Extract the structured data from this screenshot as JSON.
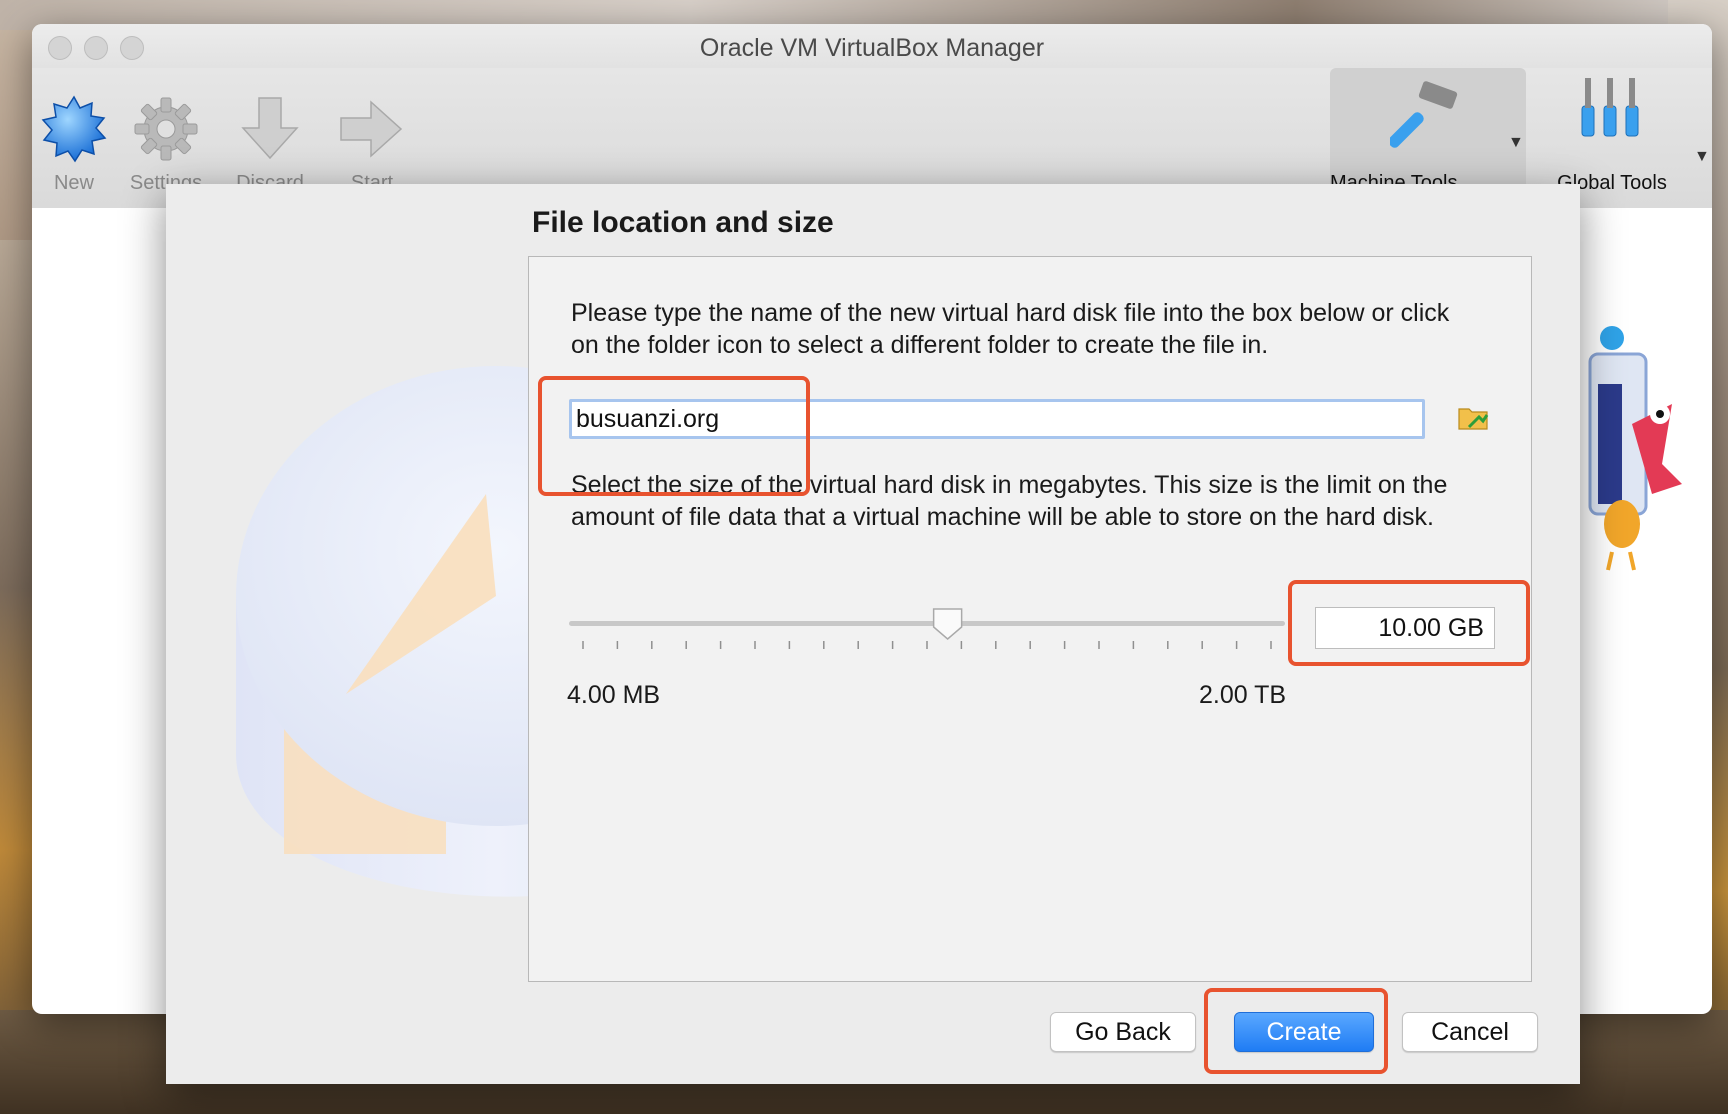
{
  "window": {
    "title": "Oracle VM VirtualBox Manager"
  },
  "toolbar": {
    "items": [
      {
        "label": "New",
        "icon": "new-icon"
      },
      {
        "label": "Settings",
        "icon": "gear-icon"
      },
      {
        "label": "Discard",
        "icon": "discard-arrow-icon"
      },
      {
        "label": "Start",
        "icon": "start-arrow-icon"
      }
    ],
    "machine_tools_label": "Machine Tools",
    "global_tools_label": "Global Tools"
  },
  "dialog": {
    "heading": "File location and size",
    "location_text": "Please type the name of the new virtual hard disk file into the box below or click on the folder icon to select a different folder to create the file in.",
    "filename_value": "busuanzi.org",
    "size_text": "Select the size of the virtual hard disk in megabytes. This size is the limit on the amount of file data that a virtual machine will be able to store on the hard disk.",
    "size_value": "10.00 GB",
    "slider_fraction": 0.53,
    "min_label": "4.00 MB",
    "max_label": "2.00 TB",
    "buttons": {
      "back": "Go Back",
      "create": "Create",
      "cancel": "Cancel"
    }
  },
  "colors": {
    "accent": "#1f7cf4",
    "highlight": "#e8532f"
  }
}
